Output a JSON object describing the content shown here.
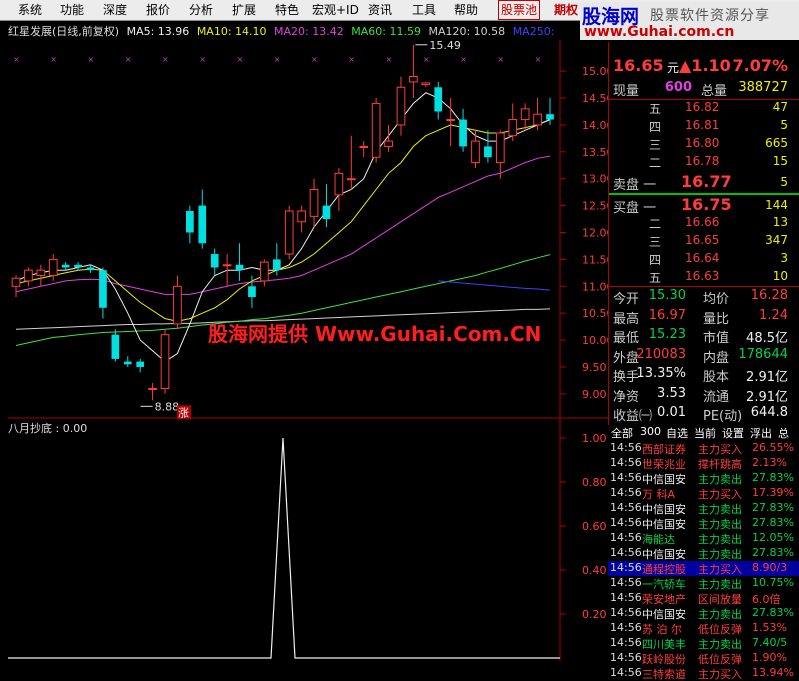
{
  "menu": {
    "items": [
      "系统",
      "功能",
      "深度",
      "报价",
      "分析",
      "扩展",
      "特色",
      "宏观+ID",
      "资讯",
      "工具",
      "帮助"
    ],
    "stock_pool": "股票池",
    "futures": "期权"
  },
  "watermark": {
    "logo": "股海网",
    "subtitle": "股票软件资源分享",
    "url": "www.Guhai.com.cn",
    "center": "股海网提供 Www.Guhai.Com.CN"
  },
  "chart": {
    "title": "红星发展(日线,前复权)",
    "ma": [
      {
        "label": "MA5: 13.96",
        "color": "#f0f0f0"
      },
      {
        "label": "MA10: 14.10",
        "color": "#f0f000"
      },
      {
        "label": "MA20: 13.42",
        "color": "#e040e0"
      },
      {
        "label": "MA60: 11.59",
        "color": "#40e040"
      },
      {
        "label": "MA120: 10.58",
        "color": "#d0d0d0"
      },
      {
        "label": "MA250:",
        "color": "#4040ff"
      }
    ],
    "y_axis": [
      "15.00",
      "14.50",
      "14.00",
      "13.50",
      "13.00",
      "12.50",
      "12.00",
      "11.50",
      "11.00",
      "10.50",
      "10.00",
      "9.50",
      "9.00"
    ],
    "high_label": "15.49",
    "low_label": "8.88",
    "limit_up_badge": "涨",
    "indicator_label": "八月抄底 : 0.00",
    "indicator_axis": [
      "1.00",
      "0.80",
      "0.60",
      "0.40",
      "0.20"
    ],
    "indicator_spike": 1.0,
    "up_color": "#ff3c3c",
    "down_color": "#00e0e0",
    "chart_data": {
      "type": "candlestick",
      "ylim": [
        8.7,
        15.3
      ],
      "candles": [
        {
          "o": 11.0,
          "h": 11.2,
          "l": 10.8,
          "c": 11.15
        },
        {
          "o": 11.1,
          "h": 11.35,
          "l": 11.0,
          "c": 11.3
        },
        {
          "o": 11.2,
          "h": 11.4,
          "l": 11.0,
          "c": 11.3
        },
        {
          "o": 11.2,
          "h": 11.6,
          "l": 11.1,
          "c": 11.5
        },
        {
          "o": 11.4,
          "h": 11.45,
          "l": 11.3,
          "c": 11.35
        },
        {
          "o": 11.4,
          "h": 11.45,
          "l": 11.3,
          "c": 11.35
        },
        {
          "o": 11.35,
          "h": 11.4,
          "l": 11.25,
          "c": 11.3
        },
        {
          "o": 11.3,
          "h": 11.35,
          "l": 10.4,
          "c": 10.6
        },
        {
          "o": 10.1,
          "h": 10.2,
          "l": 9.6,
          "c": 9.65
        },
        {
          "o": 9.6,
          "h": 9.7,
          "l": 9.5,
          "c": 9.55
        },
        {
          "o": 9.6,
          "h": 9.65,
          "l": 9.4,
          "c": 9.5
        },
        {
          "o": 9.1,
          "h": 9.2,
          "l": 8.88,
          "c": 9.1
        },
        {
          "o": 9.1,
          "h": 10.2,
          "l": 9.0,
          "c": 10.1
        },
        {
          "o": 10.3,
          "h": 11.2,
          "l": 10.2,
          "c": 11.0
        },
        {
          "o": 12.4,
          "h": 12.5,
          "l": 11.8,
          "c": 12.0
        },
        {
          "o": 12.5,
          "h": 12.8,
          "l": 11.7,
          "c": 11.8
        },
        {
          "o": 11.6,
          "h": 11.7,
          "l": 11.2,
          "c": 11.35
        },
        {
          "o": 11.4,
          "h": 11.6,
          "l": 11.0,
          "c": 11.4
        },
        {
          "o": 11.4,
          "h": 11.8,
          "l": 11.1,
          "c": 11.3
        },
        {
          "o": 11.0,
          "h": 11.2,
          "l": 10.6,
          "c": 10.8
        },
        {
          "o": 11.1,
          "h": 11.5,
          "l": 11.0,
          "c": 11.45
        },
        {
          "o": 11.5,
          "h": 11.8,
          "l": 11.2,
          "c": 11.3
        },
        {
          "o": 11.6,
          "h": 12.5,
          "l": 11.5,
          "c": 12.4
        },
        {
          "o": 12.2,
          "h": 12.5,
          "l": 12.0,
          "c": 12.4
        },
        {
          "o": 12.3,
          "h": 13.0,
          "l": 12.1,
          "c": 12.8
        },
        {
          "o": 12.5,
          "h": 12.9,
          "l": 12.1,
          "c": 12.25
        },
        {
          "o": 12.7,
          "h": 13.2,
          "l": 12.4,
          "c": 13.1
        },
        {
          "o": 13.0,
          "h": 13.8,
          "l": 12.8,
          "c": 13.0
        },
        {
          "o": 13.6,
          "h": 13.7,
          "l": 13.4,
          "c": 13.6
        },
        {
          "o": 13.4,
          "h": 14.5,
          "l": 13.3,
          "c": 14.4
        },
        {
          "o": 13.6,
          "h": 14.0,
          "l": 13.5,
          "c": 13.7
        },
        {
          "o": 14.0,
          "h": 14.9,
          "l": 13.8,
          "c": 14.7
        },
        {
          "o": 14.8,
          "h": 15.49,
          "l": 14.5,
          "c": 14.9
        },
        {
          "o": 14.75,
          "h": 14.8,
          "l": 14.7,
          "c": 14.78
        },
        {
          "o": 14.7,
          "h": 14.8,
          "l": 14.1,
          "c": 14.25
        },
        {
          "o": 14.1,
          "h": 14.5,
          "l": 13.6,
          "c": 14.1
        },
        {
          "o": 14.1,
          "h": 14.3,
          "l": 13.5,
          "c": 13.6
        },
        {
          "o": 13.3,
          "h": 13.9,
          "l": 13.2,
          "c": 13.7
        },
        {
          "o": 13.6,
          "h": 13.9,
          "l": 13.3,
          "c": 13.4
        },
        {
          "o": 13.3,
          "h": 13.9,
          "l": 13.0,
          "c": 13.85
        },
        {
          "o": 13.8,
          "h": 14.4,
          "l": 13.7,
          "c": 14.1
        },
        {
          "o": 14.1,
          "h": 14.4,
          "l": 13.9,
          "c": 14.3
        },
        {
          "o": 14.0,
          "h": 14.5,
          "l": 13.9,
          "c": 14.2
        },
        {
          "o": 14.2,
          "h": 14.5,
          "l": 14.0,
          "c": 14.1
        }
      ],
      "ma5": [
        11.1,
        11.2,
        11.25,
        11.3,
        11.3,
        11.35,
        11.4,
        11.3,
        10.95,
        10.5,
        10.0,
        9.8,
        9.6,
        9.75,
        10.3,
        10.9,
        11.2,
        11.3,
        11.3,
        11.35,
        11.3,
        11.3,
        11.4,
        11.7,
        12.1,
        12.4,
        12.7,
        12.8,
        13.0,
        13.5,
        13.8,
        14.1,
        14.4,
        14.6,
        14.5,
        14.3,
        14.0,
        13.8,
        13.7,
        13.7,
        13.8,
        13.9,
        14.0,
        14.1
      ],
      "ma10": [
        11.05,
        11.1,
        11.15,
        11.2,
        11.25,
        11.3,
        11.32,
        11.3,
        11.1,
        10.9,
        10.7,
        10.55,
        10.4,
        10.35,
        10.4,
        10.5,
        10.6,
        10.75,
        10.95,
        11.1,
        11.2,
        11.3,
        11.35,
        11.45,
        11.6,
        11.8,
        12.0,
        12.2,
        12.5,
        12.8,
        13.1,
        13.3,
        13.6,
        13.8,
        13.9,
        14.0,
        13.95,
        13.9,
        13.85,
        13.85,
        13.9,
        13.95,
        14.0,
        14.1
      ],
      "ma20": [
        10.9,
        10.95,
        11.0,
        11.05,
        11.1,
        11.12,
        11.13,
        11.12,
        11.05,
        11.0,
        10.95,
        10.9,
        10.85,
        10.85,
        10.85,
        10.9,
        10.95,
        11.0,
        11.05,
        11.08,
        11.1,
        11.12,
        11.15,
        11.2,
        11.3,
        11.4,
        11.5,
        11.6,
        11.75,
        11.9,
        12.05,
        12.2,
        12.35,
        12.5,
        12.65,
        12.75,
        12.85,
        12.95,
        13.05,
        13.1,
        13.2,
        13.3,
        13.38,
        13.42
      ],
      "ma60": [
        9.9,
        9.95,
        10.0,
        10.05,
        10.07,
        10.1,
        10.12,
        10.14,
        10.15,
        10.16,
        10.17,
        10.18,
        10.2,
        10.22,
        10.25,
        10.28,
        10.3,
        10.33,
        10.35,
        10.38,
        10.4,
        10.43,
        10.46,
        10.5,
        10.55,
        10.6,
        10.65,
        10.7,
        10.75,
        10.8,
        10.85,
        10.9,
        10.95,
        11.0,
        11.05,
        11.1,
        11.15,
        11.2,
        11.27,
        11.33,
        11.4,
        11.47,
        11.53,
        11.59
      ],
      "ma120": [
        10.2,
        10.21,
        10.22,
        10.23,
        10.24,
        10.25,
        10.26,
        10.27,
        10.28,
        10.29,
        10.29,
        10.3,
        10.3,
        10.31,
        10.31,
        10.32,
        10.33,
        10.34,
        10.35,
        10.36,
        10.36,
        10.37,
        10.38,
        10.39,
        10.4,
        10.41,
        10.42,
        10.43,
        10.44,
        10.45,
        10.46,
        10.47,
        10.48,
        10.49,
        10.5,
        10.51,
        10.52,
        10.53,
        10.54,
        10.55,
        10.56,
        10.57,
        10.57,
        10.58
      ],
      "ma250": [
        null,
        null,
        null,
        null,
        null,
        null,
        null,
        null,
        null,
        null,
        null,
        null,
        null,
        null,
        null,
        null,
        null,
        null,
        null,
        null,
        null,
        null,
        null,
        null,
        null,
        null,
        null,
        null,
        null,
        null,
        null,
        null,
        null,
        null,
        11.1,
        11.08,
        11.06,
        11.04,
        11.02,
        11.0,
        10.98,
        10.96,
        10.95,
        10.93
      ]
    }
  },
  "quote": {
    "price": "16.65",
    "change": "▲1.10",
    "change_pct": "7.07%",
    "unit": "元",
    "vol_now_label": "现量",
    "vol_now": "600",
    "vol_total_label": "总量",
    "vol_total": "388727",
    "sells": [
      {
        "label": "五",
        "price": "16.82",
        "vol": "47"
      },
      {
        "label": "四",
        "price": "16.81",
        "vol": "5"
      },
      {
        "label": "三",
        "price": "16.80",
        "vol": "665"
      },
      {
        "label": "二",
        "price": "16.78",
        "vol": "15"
      }
    ],
    "sell1": {
      "label": "卖盘 一",
      "price": "16.77",
      "vol": "5"
    },
    "buy1": {
      "label": "买盘 一",
      "price": "16.75",
      "vol": "144"
    },
    "buys": [
      {
        "label": "二",
        "price": "16.66",
        "vol": "13"
      },
      {
        "label": "三",
        "price": "16.65",
        "vol": "347"
      },
      {
        "label": "四",
        "price": "16.64",
        "vol": "3"
      },
      {
        "label": "五",
        "price": "16.63",
        "vol": "10"
      }
    ],
    "stats": [
      {
        "l1": "今开",
        "v1": "15.30",
        "c1": "grn",
        "l2": "均价",
        "v2": "16.28",
        "c2": "red"
      },
      {
        "l1": "最高",
        "v1": "16.97",
        "c1": "red",
        "l2": "量比",
        "v2": "1.24",
        "c2": "red"
      },
      {
        "l1": "最低",
        "v1": "15.23",
        "c1": "grn",
        "l2": "市值",
        "v2": "48.5亿",
        "c2": "wht"
      },
      {
        "l1": "外盘",
        "v1": "210083",
        "c1": "red",
        "l2": "内盘",
        "v2": "178644",
        "c2": "grn"
      },
      {
        "l1": "换手",
        "v1": "13.35%",
        "c1": "wht",
        "l2": "股本",
        "v2": "2.91亿",
        "c2": "wht"
      },
      {
        "l1": "净资",
        "v1": "3.53",
        "c1": "wht",
        "l2": "流通",
        "v2": "2.91亿",
        "c2": "wht"
      },
      {
        "l1": "收益㈠",
        "v1": "0.01",
        "c1": "wht",
        "l2": "PE(动)",
        "v2": "644.8",
        "c2": "wht"
      }
    ]
  },
  "ticks": {
    "tabs": [
      "全部",
      "300",
      "自选",
      "当前",
      "设置",
      "浮出",
      "总"
    ],
    "rows": [
      {
        "t": "14:56",
        "name": "西部证券",
        "nc": "red",
        "type": "主力买入",
        "tc": "red",
        "val": "26.55%"
      },
      {
        "t": "14:56",
        "name": "世荣兆业",
        "nc": "red",
        "type": "撑杆跳高",
        "tc": "red",
        "val": "2.13%"
      },
      {
        "t": "14:56",
        "name": "中信国安",
        "nc": "wht",
        "type": "主力卖出",
        "tc": "grn",
        "val": "27.83%"
      },
      {
        "t": "14:56",
        "name": "万 科A",
        "nc": "red",
        "type": "主力买入",
        "tc": "red",
        "val": "17.39%"
      },
      {
        "t": "14:56",
        "name": "中信国安",
        "nc": "wht",
        "type": "主力卖出",
        "tc": "grn",
        "val": "27.83%"
      },
      {
        "t": "14:56",
        "name": "中信国安",
        "nc": "wht",
        "type": "主力卖出",
        "tc": "grn",
        "val": "27.83%"
      },
      {
        "t": "14:56",
        "name": "海能达",
        "nc": "grn",
        "type": "主力卖出",
        "tc": "grn",
        "val": "12.05%"
      },
      {
        "t": "14:56",
        "name": "中信国安",
        "nc": "wht",
        "type": "主力卖出",
        "tc": "grn",
        "val": "27.83%"
      },
      {
        "t": "14:56",
        "name": "通程控股",
        "nc": "red",
        "type": "主力买入",
        "tc": "red",
        "val": "8.90/3"
      },
      {
        "t": "14:56",
        "name": "一汽轿车",
        "nc": "grn",
        "type": "主力卖出",
        "tc": "grn",
        "val": "10.75%"
      },
      {
        "t": "14:56",
        "name": "荣安地产",
        "nc": "red",
        "type": "区间放量",
        "tc": "red",
        "val": "6.0倍"
      },
      {
        "t": "14:56",
        "name": "中信国安",
        "nc": "wht",
        "type": "主力卖出",
        "tc": "grn",
        "val": "27.83%"
      },
      {
        "t": "14:56",
        "name": "苏 泊 尔",
        "nc": "red",
        "type": "低位反弹",
        "tc": "red",
        "val": "1.53%"
      },
      {
        "t": "14:56",
        "name": "四川美丰",
        "nc": "grn",
        "type": "主力卖出",
        "tc": "grn",
        "val": "7.40/5"
      },
      {
        "t": "14:56",
        "name": "跃岭股份",
        "nc": "red",
        "type": "低位反弹",
        "tc": "red",
        "val": "1.90%"
      },
      {
        "t": "14:56",
        "name": "三特索道",
        "nc": "red",
        "type": "主力买入",
        "tc": "red",
        "val": "13.94%"
      }
    ]
  }
}
